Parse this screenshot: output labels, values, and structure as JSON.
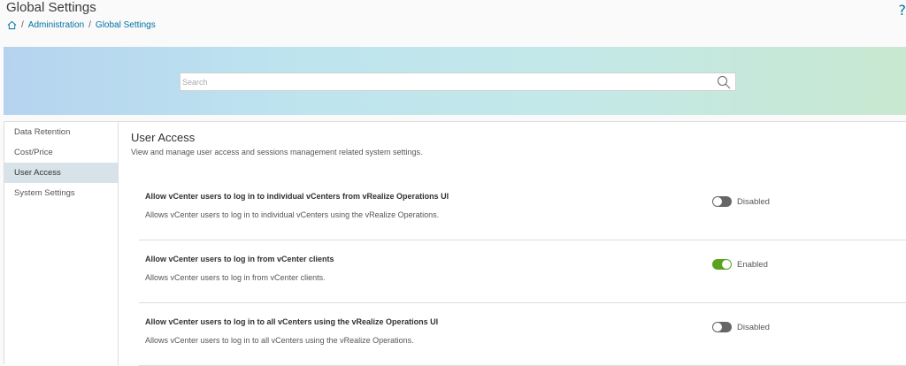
{
  "header": {
    "title": "Global Settings",
    "help_glyph": "?"
  },
  "breadcrumb": {
    "items": [
      "Administration",
      "Global Settings"
    ],
    "separator": "/"
  },
  "search": {
    "placeholder": "Search"
  },
  "sidebar": {
    "items": [
      {
        "label": "Data Retention",
        "active": false
      },
      {
        "label": "Cost/Price",
        "active": false
      },
      {
        "label": "User Access",
        "active": true
      },
      {
        "label": "System Settings",
        "active": false
      }
    ]
  },
  "main": {
    "title": "User Access",
    "description": "View and manage user access and sessions management related system settings.",
    "settings": [
      {
        "title": "Allow vCenter users to log in to individual vCenters from vRealize Operations UI",
        "description": "Allows vCenter users to log in to individual vCenters using the vRealize Operations.",
        "state": "Disabled",
        "enabled": false
      },
      {
        "title": "Allow vCenter users to log in from vCenter clients",
        "description": "Allows vCenter users to log in from vCenter clients.",
        "state": "Enabled",
        "enabled": true
      },
      {
        "title": "Allow vCenter users to log in to all vCenters using the vRealize Operations UI",
        "description": "Allows vCenter users to log in to all vCenters using the vRealize Operations.",
        "state": "Disabled",
        "enabled": false
      }
    ]
  },
  "colors": {
    "link": "#0072a3",
    "toggle_on": "#5aa220",
    "toggle_off": "#666666",
    "active_nav": "#d8e3e9"
  }
}
